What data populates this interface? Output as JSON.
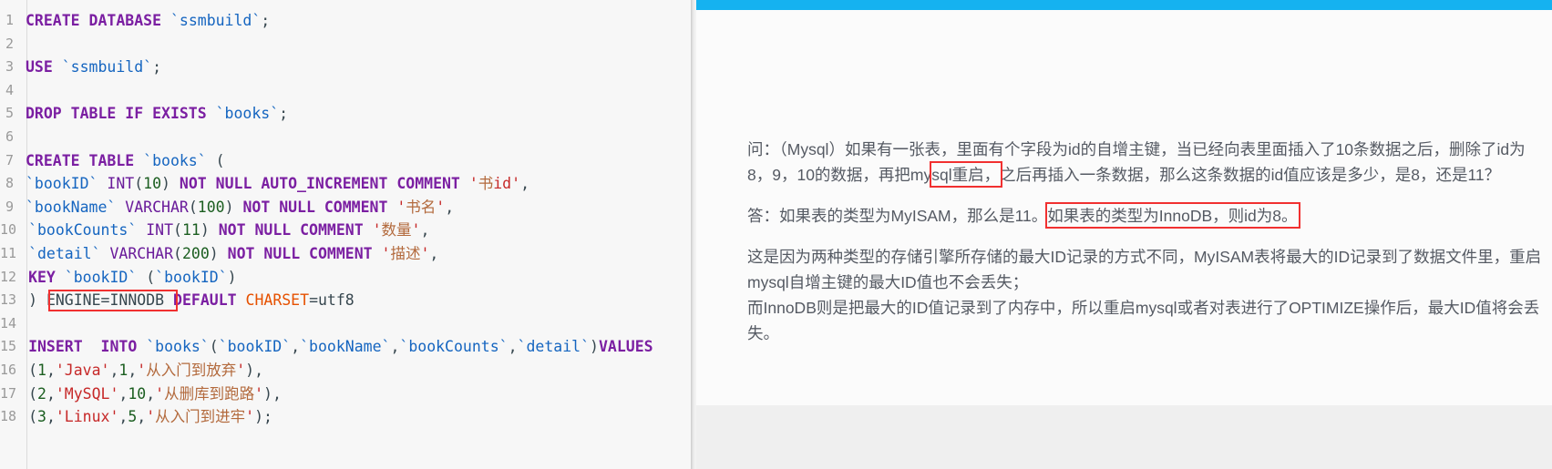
{
  "editor": {
    "name": "sql-code-editor",
    "gutter_start": 1,
    "annotation_color": "#f13030",
    "lines": [
      {
        "n": "1",
        "tokens": [
          {
            "t": "kw",
            "v": "CREATE DATABASE "
          },
          {
            "t": "ident",
            "v": "`ssmbuild`"
          },
          {
            "t": "op",
            "v": ";"
          }
        ]
      },
      {
        "n": "2",
        "tokens": []
      },
      {
        "n": "3",
        "tokens": [
          {
            "t": "kw",
            "v": "USE "
          },
          {
            "t": "ident",
            "v": "`ssmbuild`"
          },
          {
            "t": "op",
            "v": ";"
          }
        ]
      },
      {
        "n": "4",
        "tokens": []
      },
      {
        "n": "5",
        "tokens": [
          {
            "t": "kw",
            "v": "DROP TABLE IF EXISTS "
          },
          {
            "t": "ident",
            "v": "`books`"
          },
          {
            "t": "op",
            "v": ";"
          }
        ]
      },
      {
        "n": "6",
        "tokens": []
      },
      {
        "n": "7",
        "tokens": [
          {
            "t": "kw",
            "v": "CREATE TABLE "
          },
          {
            "t": "ident",
            "v": "`books`"
          },
          {
            "t": "op",
            "v": " ("
          }
        ]
      },
      {
        "n": "8",
        "tokens": [
          {
            "t": "ident",
            "v": "`bookID`"
          },
          {
            "t": "op",
            "v": " "
          },
          {
            "t": "type",
            "v": "INT"
          },
          {
            "t": "op",
            "v": "("
          },
          {
            "t": "num",
            "v": "10"
          },
          {
            "t": "op",
            "v": ") "
          },
          {
            "t": "kw",
            "v": "NOT NULL AUTO_INCREMENT COMMENT "
          },
          {
            "t": "str",
            "v": "'"
          },
          {
            "t": "cn",
            "v": "书"
          },
          {
            "t": "str",
            "v": "id'"
          },
          {
            "t": "op",
            "v": ","
          }
        ]
      },
      {
        "n": "9",
        "tokens": [
          {
            "t": "ident",
            "v": "`bookName`"
          },
          {
            "t": "op",
            "v": " "
          },
          {
            "t": "type",
            "v": "VARCHAR"
          },
          {
            "t": "op",
            "v": "("
          },
          {
            "t": "num",
            "v": "100"
          },
          {
            "t": "op",
            "v": ") "
          },
          {
            "t": "kw",
            "v": "NOT NULL COMMENT "
          },
          {
            "t": "str",
            "v": "'"
          },
          {
            "t": "cn",
            "v": "书名"
          },
          {
            "t": "str",
            "v": "'"
          },
          {
            "t": "op",
            "v": ","
          }
        ]
      },
      {
        "n": "10",
        "tokens": [
          {
            "t": "ident",
            "v": "`bookCounts`"
          },
          {
            "t": "op",
            "v": " "
          },
          {
            "t": "type",
            "v": "INT"
          },
          {
            "t": "op",
            "v": "("
          },
          {
            "t": "num",
            "v": "11"
          },
          {
            "t": "op",
            "v": ") "
          },
          {
            "t": "kw",
            "v": "NOT NULL COMMENT "
          },
          {
            "t": "str",
            "v": "'"
          },
          {
            "t": "cn",
            "v": "数量"
          },
          {
            "t": "str",
            "v": "'"
          },
          {
            "t": "op",
            "v": ","
          }
        ]
      },
      {
        "n": "11",
        "tokens": [
          {
            "t": "ident",
            "v": "`detail`"
          },
          {
            "t": "op",
            "v": " "
          },
          {
            "t": "type",
            "v": "VARCHAR"
          },
          {
            "t": "op",
            "v": "("
          },
          {
            "t": "num",
            "v": "200"
          },
          {
            "t": "op",
            "v": ") "
          },
          {
            "t": "kw",
            "v": "NOT NULL COMMENT "
          },
          {
            "t": "str",
            "v": "'"
          },
          {
            "t": "cn",
            "v": "描述"
          },
          {
            "t": "str",
            "v": "'"
          },
          {
            "t": "op",
            "v": ","
          }
        ]
      },
      {
        "n": "12",
        "tokens": [
          {
            "t": "kw",
            "v": "KEY "
          },
          {
            "t": "ident",
            "v": "`bookID`"
          },
          {
            "t": "op",
            "v": " ("
          },
          {
            "t": "ident",
            "v": "`bookID`"
          },
          {
            "t": "op",
            "v": ")"
          }
        ]
      },
      {
        "n": "13",
        "tokens": [
          {
            "t": "op",
            "v": ") "
          },
          {
            "t": "plain",
            "v": "ENGINE"
          },
          {
            "t": "op",
            "v": "="
          },
          {
            "t": "plain",
            "v": "INNODB "
          },
          {
            "t": "kw",
            "v": "DEFAULT "
          },
          {
            "t": "attr",
            "v": "CHARSET"
          },
          {
            "t": "op",
            "v": "="
          },
          {
            "t": "plain",
            "v": "utf8"
          }
        ]
      },
      {
        "n": "14",
        "tokens": []
      },
      {
        "n": "15",
        "tokens": [
          {
            "t": "kw",
            "v": "INSERT  INTO "
          },
          {
            "t": "ident",
            "v": "`books`"
          },
          {
            "t": "op",
            "v": "("
          },
          {
            "t": "ident",
            "v": "`bookID`"
          },
          {
            "t": "op",
            "v": ","
          },
          {
            "t": "ident",
            "v": "`bookName`"
          },
          {
            "t": "op",
            "v": ","
          },
          {
            "t": "ident",
            "v": "`bookCounts`"
          },
          {
            "t": "op",
            "v": ","
          },
          {
            "t": "ident",
            "v": "`detail`"
          },
          {
            "t": "op",
            "v": ")"
          },
          {
            "t": "kw",
            "v": "VALUES"
          }
        ]
      },
      {
        "n": "16",
        "tokens": [
          {
            "t": "op",
            "v": "("
          },
          {
            "t": "num",
            "v": "1"
          },
          {
            "t": "op",
            "v": ","
          },
          {
            "t": "str",
            "v": "'Java'"
          },
          {
            "t": "op",
            "v": ","
          },
          {
            "t": "num",
            "v": "1"
          },
          {
            "t": "op",
            "v": ","
          },
          {
            "t": "str",
            "v": "'"
          },
          {
            "t": "cn",
            "v": "从入门到放弃"
          },
          {
            "t": "str",
            "v": "'"
          },
          {
            "t": "op",
            "v": "),"
          }
        ]
      },
      {
        "n": "17",
        "tokens": [
          {
            "t": "op",
            "v": "("
          },
          {
            "t": "num",
            "v": "2"
          },
          {
            "t": "op",
            "v": ","
          },
          {
            "t": "str",
            "v": "'MySQL'"
          },
          {
            "t": "op",
            "v": ","
          },
          {
            "t": "num",
            "v": "10"
          },
          {
            "t": "op",
            "v": ","
          },
          {
            "t": "str",
            "v": "'"
          },
          {
            "t": "cn",
            "v": "从删库到跑路"
          },
          {
            "t": "str",
            "v": "'"
          },
          {
            "t": "op",
            "v": "),"
          }
        ]
      },
      {
        "n": "18",
        "tokens": [
          {
            "t": "op",
            "v": "("
          },
          {
            "t": "num",
            "v": "3"
          },
          {
            "t": "op",
            "v": ","
          },
          {
            "t": "str",
            "v": "'Linux'"
          },
          {
            "t": "op",
            "v": ","
          },
          {
            "t": "num",
            "v": "5"
          },
          {
            "t": "op",
            "v": ","
          },
          {
            "t": "str",
            "v": "'"
          },
          {
            "t": "cn",
            "v": "从入门到进牢"
          },
          {
            "t": "str",
            "v": "'"
          },
          {
            "t": "op",
            "v": ");"
          }
        ]
      }
    ],
    "annotations": [
      {
        "name": "annotation-engine-innodb",
        "label": "ENGINE=INNODB"
      }
    ]
  },
  "right_panel": {
    "topbar_color": "#15b2f0",
    "card_background": "#fbfbfb",
    "page_background": "#efefef",
    "question": {
      "prefix": "问：（Mysql）如果有一张表，里面有个字段为id的自增主键，当已经向表里面插入了10条数据之后，删除了id为8，9，10的数据，再把my",
      "highlight": "sql重启，",
      "suffix": "之后再插入一条数据，那么这条数据的id值应该是多少，是8，还是11？"
    },
    "answer": {
      "prefix": "答：如果表的类型为MyISAM，那么是11。",
      "highlight": "如果表的类型为InnoDB，则id为8。",
      "suffix": ""
    },
    "explanation_lines": [
      "这是因为两种类型的存储引擎所存储的最大ID记录的方式不同，MyISAM表将最大的ID记录到了数据文件里，重启mysql自增主键的最大ID值也不会丢失；",
      "而InnoDB则是把最大的ID值记录到了内存中，所以重启mysql或者对表进行了OPTIMIZE操作后，最大ID值将会丢失。"
    ]
  }
}
